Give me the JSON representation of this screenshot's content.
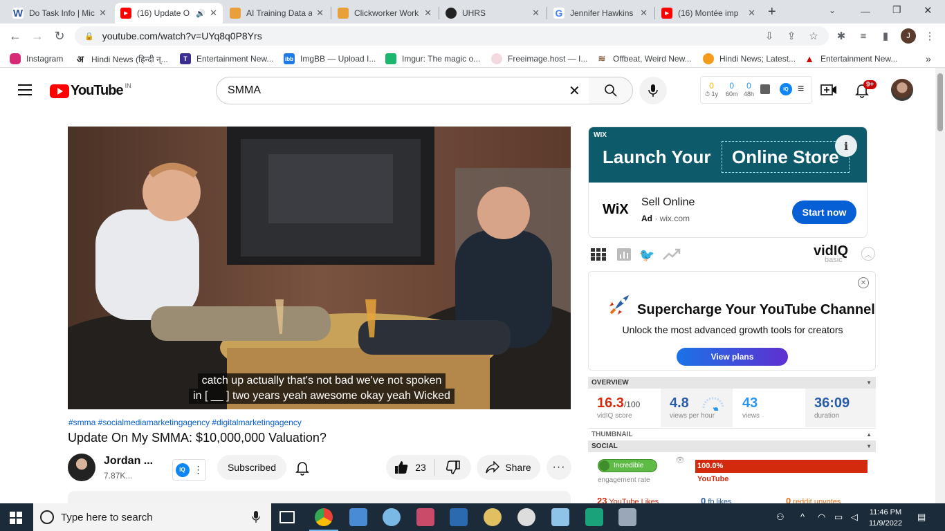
{
  "browser": {
    "tabs": [
      {
        "title": "Do Task Info | Mic",
        "favicon_color": "#2a5298",
        "favicon_letter": "W",
        "active": false
      },
      {
        "title": "(16) Update O",
        "favicon_color": "#ff0000",
        "favicon_letter": "▶",
        "active": true
      },
      {
        "title": "AI Training Data a",
        "favicon_color": "#e8a13a",
        "favicon_letter": "A",
        "active": false
      },
      {
        "title": "Clickworker Work",
        "favicon_color": "#e8a13a",
        "favicon_letter": "C",
        "active": false
      },
      {
        "title": "UHRS",
        "favicon_color": "#222222",
        "favicon_letter": "U",
        "active": false
      },
      {
        "title": "Jennifer Hawkins",
        "favicon_color": "#4285f4",
        "favicon_letter": "G",
        "active": false
      },
      {
        "title": "(16) Montée imp",
        "favicon_color": "#ff0000",
        "favicon_letter": "▶",
        "active": false
      }
    ],
    "new_tab": "+",
    "url": "youtube.com/watch?v=UYq8q0P8Yrs",
    "profile_initial": "J",
    "bookmarks": [
      {
        "label": "Instagram",
        "color": "#d62976"
      },
      {
        "label": "Hindi News (हिन्दी न्...",
        "color": "#222222"
      },
      {
        "label": "Entertainment New...",
        "color": "#3a2f8f"
      },
      {
        "label": "ImgBB — Upload I...",
        "color": "#1e7ae6"
      },
      {
        "label": "Imgur: The magic o...",
        "color": "#1bb76e"
      },
      {
        "label": "Freeimage.host — I...",
        "color": "#d9a8b5"
      },
      {
        "label": "Offbeat, Weird New...",
        "color": "#8a6a4a"
      },
      {
        "label": "Hindi News; Latest...",
        "color": "#f59b1c"
      },
      {
        "label": "Entertainment New...",
        "color": "#d00000"
      }
    ],
    "bookmarks_overflow": "»"
  },
  "youtube": {
    "logo_text": "YouTube",
    "country": "IN",
    "search_value": "SMMA",
    "vidiq_header_stats": [
      {
        "value": "0",
        "label": "1y",
        "color": "#f5b400"
      },
      {
        "value": "0",
        "label": "60m",
        "color": "#2996f0"
      },
      {
        "value": "0",
        "label": "48h",
        "color": "#2996f0"
      }
    ],
    "notifications": "9+",
    "video": {
      "caption_line1": "catch up actually that's not bad we've not spoken",
      "caption_line2": "in [ __ ] two years yeah awesome okay yeah Wicked",
      "hashtags": "#smma #socialmediamarketingagency #digitalmarketingagency",
      "title": "Update On My SMMA: $10,000,000 Valuation?",
      "channel_name": "Jordan ...",
      "subscribers": "7.87K...",
      "subscribe_label": "Subscribed",
      "likes": "23",
      "share_label": "Share",
      "more_label": "···"
    },
    "ad": {
      "brand_small": "WIX",
      "headline_1": "Launch Your",
      "headline_2": "Online Store",
      "info_icon": "i",
      "brand_logo": "WiX",
      "title": "Sell Online",
      "ad_label": "Ad",
      "domain": "· wix.com",
      "cta": "Start now"
    },
    "vidiq": {
      "logo": "vidIQ",
      "tier": "basic",
      "promo_title": "Supercharge Your YouTube Channel",
      "promo_sub": "Unlock the most advanced growth tools for creators",
      "promo_cta": "View plans",
      "overview_label": "OVERVIEW",
      "overview": [
        {
          "value": "16.3",
          "suffix": "/100",
          "label": "vidIQ score",
          "color": "#d32a0e"
        },
        {
          "value": "4.8",
          "label": "views per hour",
          "color": "#2b5ca8"
        },
        {
          "value": "43",
          "label": "views",
          "color": "#2996f0"
        },
        {
          "value": "36:09",
          "label": "duration",
          "color": "#2b5ca8"
        }
      ],
      "thumbnail_label": "THUMBNAIL",
      "social_label": "SOCIAL",
      "engagement_badge": "Incredible",
      "engagement_label": "engagement rate",
      "yt_percent": "100.0%",
      "yt_percent_value": 100,
      "yt_label": "YouTube",
      "social_counts": [
        {
          "value": "23",
          "label": "YouTube Likes",
          "color": "#d32a0e"
        },
        {
          "value": "0",
          "label": "fb likes",
          "color": "#2b5ca8"
        },
        {
          "value": "0",
          "label": "reddit upvotes",
          "color": "#e8701a"
        }
      ]
    }
  },
  "taskbar": {
    "search_placeholder": "Type here to search",
    "time": "11:46 PM",
    "date": "11/9/2022"
  }
}
